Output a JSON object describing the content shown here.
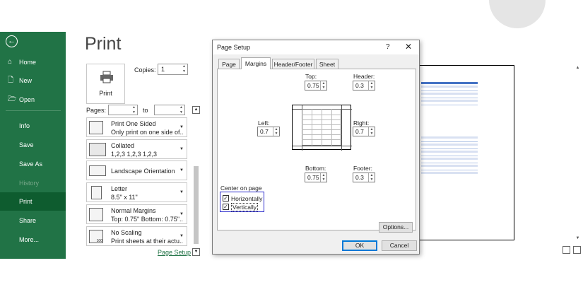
{
  "nav": {
    "items": [
      {
        "label": "Home",
        "icon": "home-icon",
        "glyph": "⌂"
      },
      {
        "label": "New",
        "icon": "new-document-icon",
        "glyph": "🗋"
      },
      {
        "label": "Open",
        "icon": "folder-open-icon",
        "glyph": "🗁"
      },
      {
        "label": "Info"
      },
      {
        "label": "Save"
      },
      {
        "label": "Save As"
      },
      {
        "label": "History"
      },
      {
        "label": "Print"
      },
      {
        "label": "Share"
      },
      {
        "label": "More..."
      }
    ],
    "active": "Print",
    "disabled": "History",
    "back_glyph": "←"
  },
  "print": {
    "title": "Print",
    "print_button": "Print",
    "copies_label": "Copies:",
    "copies_value": "1",
    "pages_label": "Pages:",
    "to_label": "to",
    "options": [
      {
        "line1": "Print One Sided",
        "line2": "Only print on one side of..."
      },
      {
        "line1": "Collated",
        "line2": "1,2,3    1,2,3    1,2,3"
      },
      {
        "line1": "Landscape Orientation",
        "line2": ""
      },
      {
        "line1": "Letter",
        "line2": "8.5\" x 11\""
      },
      {
        "line1": "Normal Margins",
        "line2": "Top: 0.75\" Bottom: 0.75\"..."
      },
      {
        "line1": "No Scaling",
        "line2": "Print sheets at their actu..."
      }
    ],
    "scaling_thumb_text": "100",
    "page_setup_link": "Page Setup"
  },
  "dialog": {
    "title": "Page Setup",
    "help": "?",
    "close": "✕",
    "tabs": [
      "Page",
      "Margins",
      "Header/Footer",
      "Sheet"
    ],
    "active_tab": "Margins",
    "margins": {
      "top_label": "Top:",
      "top": "0.75",
      "header_label": "Header:",
      "header": "0.3",
      "left_label": "Left:",
      "left": "0.7",
      "right_label": "Right:",
      "right": "0.7",
      "bottom_label": "Bottom:",
      "bottom": "0.75",
      "footer_label": "Footer:",
      "footer": "0.3"
    },
    "center_on_page_label": "Center on page",
    "horizontally_label": "Horizontally",
    "horizontally_checked": true,
    "vertically_label": "Vertically",
    "vertically_checked": true,
    "options_button": "Options...",
    "ok_button": "OK",
    "cancel_button": "Cancel"
  },
  "colors": {
    "nav_green": "#217346",
    "nav_active": "#0e5c2f",
    "highlight_border": "#2d2dcc",
    "preview_header": "#4472c4"
  }
}
